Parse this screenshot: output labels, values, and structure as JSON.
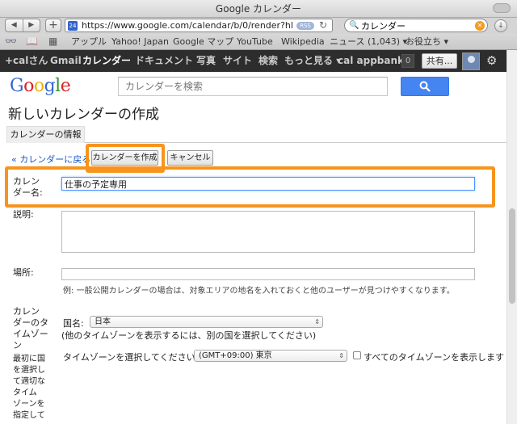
{
  "window": {
    "title": "Google カレンダー"
  },
  "toolbar": {
    "back_icon": "◀",
    "forward_icon": "▶",
    "add_icon": "+",
    "favicon_text": "24",
    "url": "https://www.google.com/calendar/b/0/render?hl=ja&",
    "rss_label": "RSS",
    "search_value": "カレンダー"
  },
  "bookmarks": [
    "アップル",
    "Yahoo! Japan",
    "Google マップ",
    "YouTube",
    "Wikipedia",
    "ニュース (1,043) ▾",
    "お役立ち ▾"
  ],
  "gbar": {
    "items": [
      "+calさん",
      "Gmail",
      "カレンダー",
      "ドキュメント",
      "写真",
      "サイト",
      "検索",
      "もっと見る ▾",
      "cal appbank"
    ],
    "count": "0",
    "share": "共有..."
  },
  "search": {
    "placeholder": "カレンダーを検索"
  },
  "page": {
    "title": "新しいカレンダーの作成",
    "tab": "カレンダーの情報",
    "back_link": "« カレンダーに戻る",
    "create_button": "カレンダーを作成",
    "cancel_button": "キャンセル"
  },
  "form": {
    "name_label_1": "カレン",
    "name_label_2": "ダー名:",
    "name_value": "仕事の予定専用",
    "description_label": "説明:",
    "location_label": "場所:",
    "location_hint": "例: 一般公開カレンダーの場合は、対象エリアの地名を入れておくと他のユーザーが見つけやすくなります。",
    "tz_label_lines": [
      "カレン",
      "ダーのタ",
      "イムゾー",
      "ン",
      "最初に国",
      "を選択し",
      "て適切な",
      "タイム",
      "ゾーンを",
      "指定して"
    ],
    "country_label": "国名:",
    "country_value": "日本",
    "country_hint": "(他のタイムゾーンを表示するには、別の国を選択してください)",
    "tz_select_label": "タイムゾーンを選択してください:",
    "tz_value": "(GMT+09:00) 東京",
    "show_all_tz": "すべてのタイムゾーンを表示します"
  },
  "colors": {
    "highlight": "#f7941d",
    "link": "#1155cc",
    "search_button": "#4585f2"
  }
}
